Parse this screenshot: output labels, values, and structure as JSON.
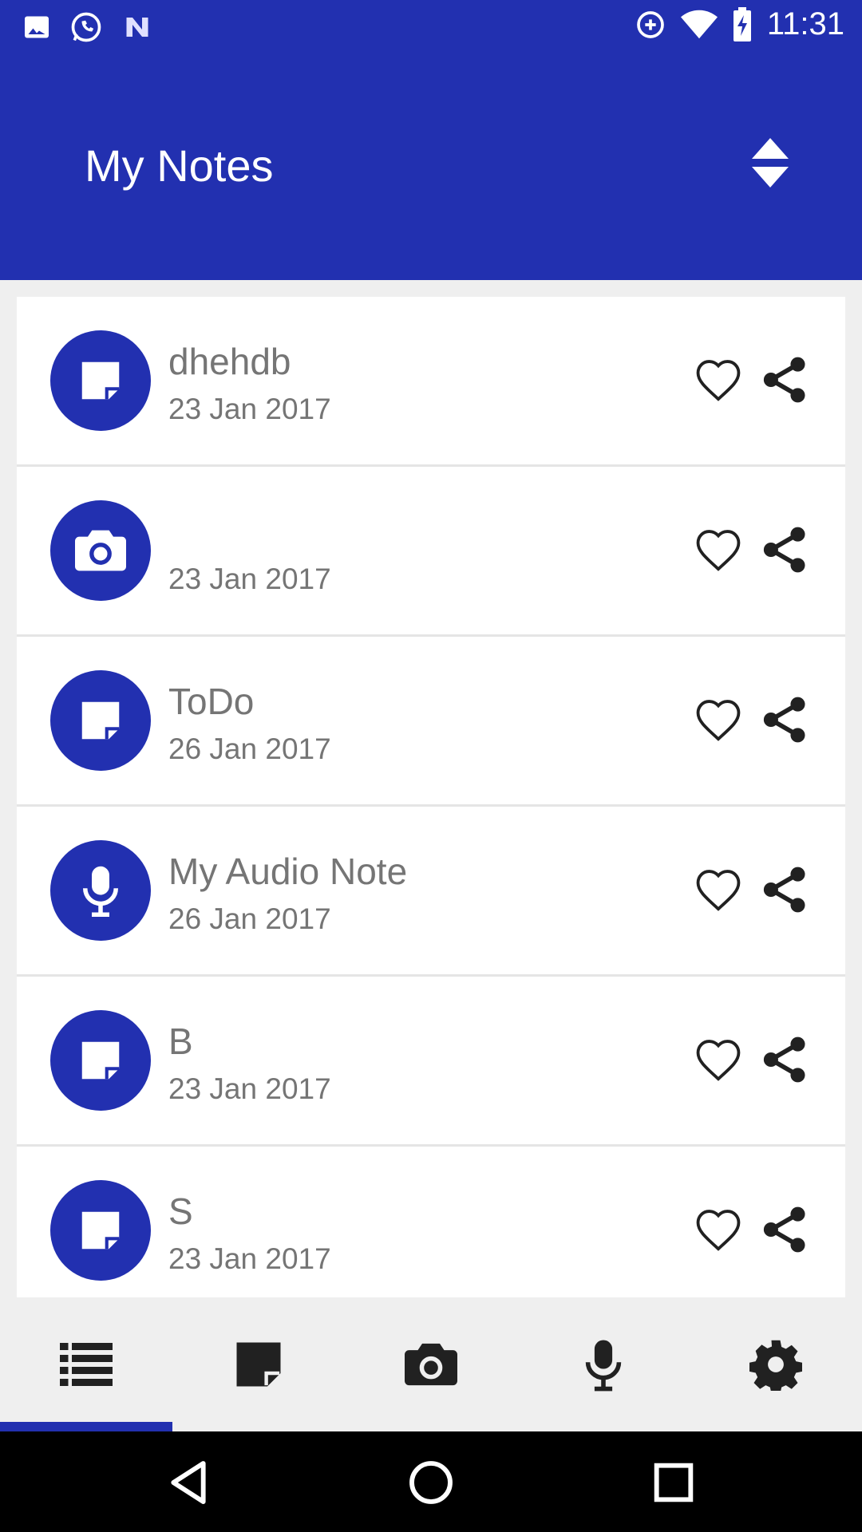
{
  "status_bar": {
    "time": "11:31",
    "left_icons": [
      "image-icon",
      "whatsapp-icon",
      "n-icon"
    ],
    "right_icons": [
      "data-saver-icon",
      "wifi-icon",
      "battery-charging-icon"
    ]
  },
  "app_bar": {
    "title": "My Notes",
    "sort_icon": "sort-up-down-icon"
  },
  "notes": [
    {
      "title": "dhehdb",
      "date": "23 Jan 2017",
      "type_icon": "note-icon"
    },
    {
      "title": "",
      "date": "23 Jan 2017",
      "type_icon": "camera-icon"
    },
    {
      "title": "ToDo",
      "date": "26 Jan 2017",
      "type_icon": "note-icon"
    },
    {
      "title": "My Audio Note",
      "date": "26 Jan 2017",
      "type_icon": "microphone-icon"
    },
    {
      "title": "B",
      "date": "23 Jan 2017",
      "type_icon": "note-icon"
    },
    {
      "title": "S",
      "date": "23 Jan 2017",
      "type_icon": "note-icon"
    }
  ],
  "bottom_nav": {
    "items": [
      "list-icon",
      "note-icon",
      "camera-icon",
      "microphone-icon",
      "gear-icon"
    ],
    "selected": "list-icon"
  },
  "system_nav": [
    "back-icon",
    "home-icon",
    "recents-icon"
  ],
  "colors": {
    "primary": "#2230b0",
    "text_secondary": "#757575",
    "background": "#efefef",
    "icon_dark": "#212121"
  }
}
